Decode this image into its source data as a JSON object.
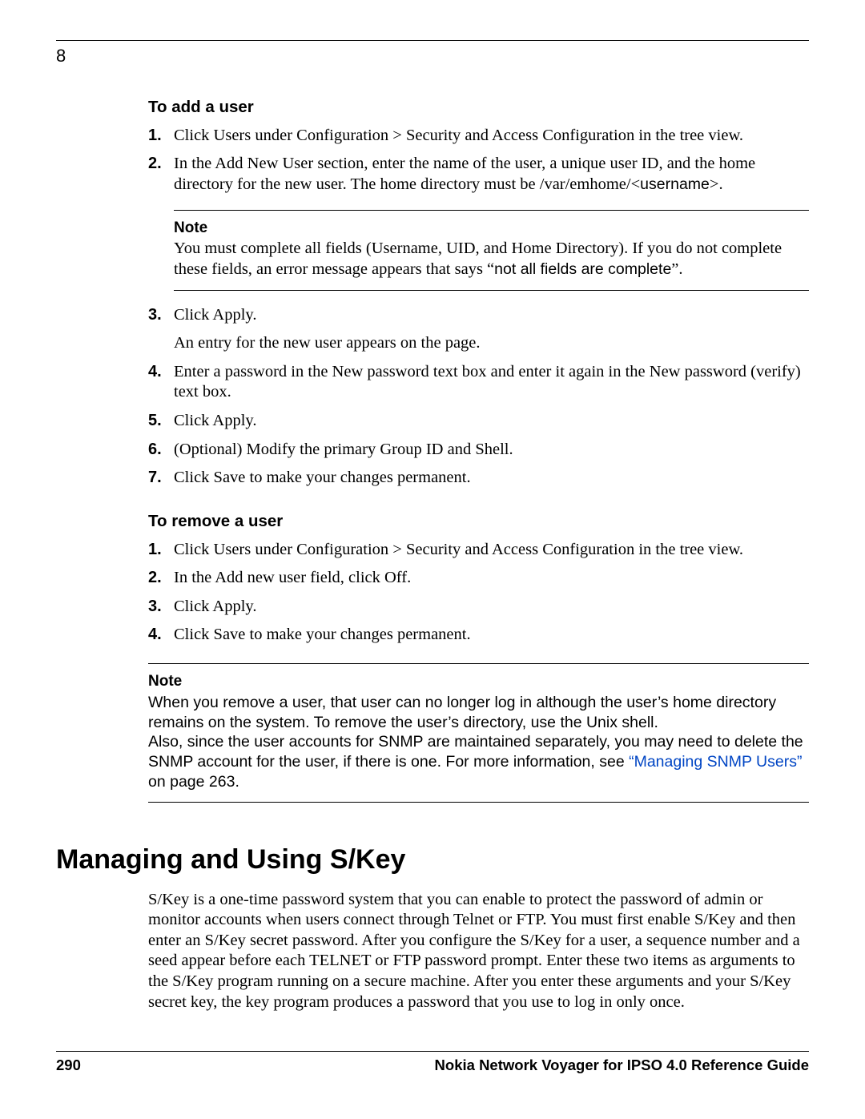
{
  "chapter_number": "8",
  "add_user": {
    "heading": "To add a user",
    "steps": [
      "Click Users under Configuration > Security and Access Configuration in the tree view.",
      {
        "pre": "In the Add New User section, enter the name of the user, a unique user ID, and the home directory for the new user. The home directory must be /var/emhome/<",
        "code": "username",
        "post": ">."
      }
    ],
    "note_label": "Note",
    "note_pre": "You must complete all fields (Username, UID, and Home Directory). If you do not complete these fields, an error message appears that says “",
    "note_code": "not all fields are complete",
    "note_post": "”.",
    "steps2": [
      {
        "text": "Click Apply.",
        "follow": "An entry for the new user appears on the page."
      },
      {
        "text": "Enter a password in the New password text box and enter it again in the New password (verify) text box."
      },
      {
        "text": "Click Apply."
      },
      {
        "text": "(Optional) Modify the primary Group ID and Shell."
      },
      {
        "text": "Click Save to make your changes permanent."
      }
    ]
  },
  "remove_user": {
    "heading": "To remove a user",
    "steps": [
      "Click Users under Configuration > Security and Access Configuration in the tree view.",
      "In the Add new user field, click Off.",
      "Click Apply.",
      "Click Save to make your changes permanent."
    ]
  },
  "note2": {
    "label": "Note",
    "line1": "When you remove a user, that user can no longer log in although the user’s home directory remains on the system. To remove the user’s directory, use the Unix shell.",
    "line2_pre": "Also, since the user accounts for SNMP are maintained separately, you may need to delete the SNMP account for the user, if there is one. For more information, see ",
    "link": "“Managing SNMP Users”",
    "line2_post": " on page 263."
  },
  "skey": {
    "heading": "Managing and Using S/Key",
    "body": "S/Key is a one-time password system that you can enable to protect the password of admin or monitor accounts when users connect through Telnet or FTP. You must first enable S/Key and then enter an S/Key secret password. After you configure the S/Key for a user, a sequence number and a seed  appear before each TELNET or FTP password prompt. Enter these two items as arguments to the S/Key program running on a secure machine. After you enter these arguments and your S/Key secret key, the key program produces a password that you use to log in only once."
  },
  "footer": {
    "page_number": "290",
    "doc_title": "Nokia Network Voyager for IPSO 4.0 Reference Guide"
  }
}
